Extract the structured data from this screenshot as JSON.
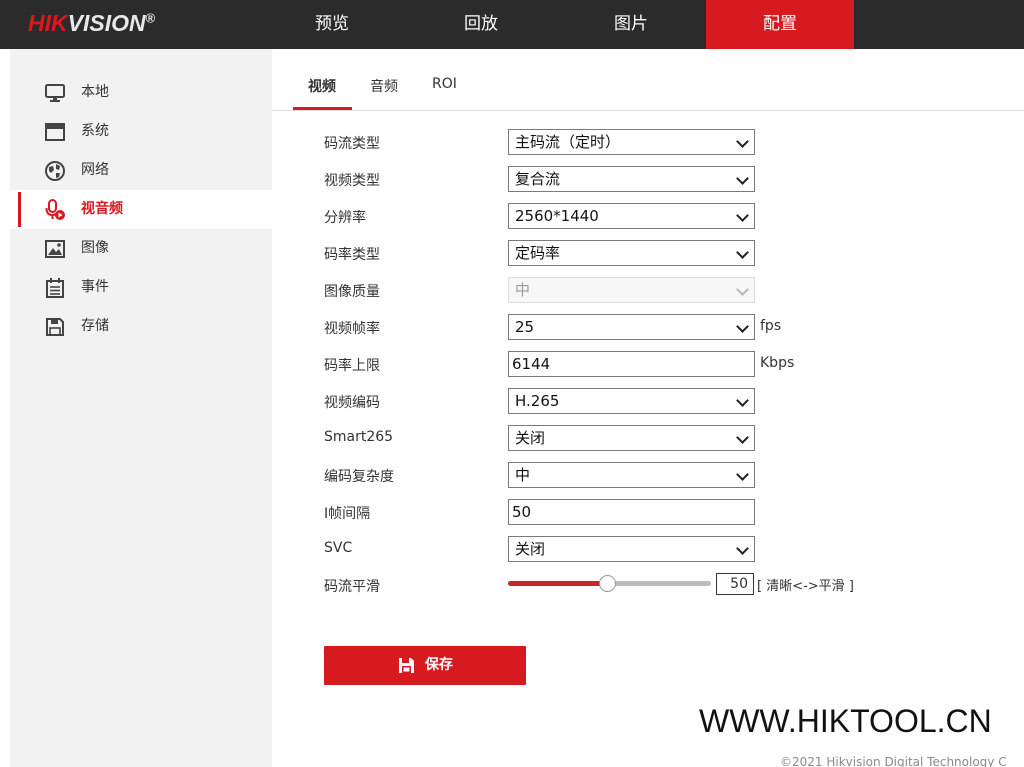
{
  "header": {
    "logo_part1": "HIK",
    "logo_part2": "VISION",
    "logo_reg": "®",
    "nav": [
      "预览",
      "回放",
      "图片",
      "配置"
    ],
    "active_nav": "配置"
  },
  "sidebar": {
    "items": [
      {
        "label": "本地",
        "icon": "monitor-icon"
      },
      {
        "label": "系统",
        "icon": "window-icon"
      },
      {
        "label": "网络",
        "icon": "globe-icon"
      },
      {
        "label": "视音频",
        "icon": "microphone-icon"
      },
      {
        "label": "图像",
        "icon": "image-icon"
      },
      {
        "label": "事件",
        "icon": "calendar-icon"
      },
      {
        "label": "存储",
        "icon": "save-icon"
      }
    ],
    "active": "视音频"
  },
  "tabs": {
    "items": [
      "视频",
      "音频",
      "ROI"
    ],
    "active": "视频"
  },
  "form": {
    "stream_type": {
      "label": "码流类型",
      "value": "主码流（定时）"
    },
    "video_type": {
      "label": "视频类型",
      "value": "复合流"
    },
    "resolution": {
      "label": "分辨率",
      "value": "2560*1440"
    },
    "bitrate_type": {
      "label": "码率类型",
      "value": "定码率"
    },
    "image_quality": {
      "label": "图像质量",
      "value": "中"
    },
    "frame_rate": {
      "label": "视频帧率",
      "value": "25",
      "unit": "fps"
    },
    "max_bitrate": {
      "label": "码率上限",
      "value": "6144",
      "unit": "Kbps"
    },
    "video_encoding": {
      "label": "视频编码",
      "value": "H.265"
    },
    "smart265": {
      "label": "Smart265",
      "value": "关闭"
    },
    "encoding_complexity": {
      "label": "编码复杂度",
      "value": "中"
    },
    "i_frame_interval": {
      "label": "I帧间隔",
      "value": "50"
    },
    "svc": {
      "label": "SVC",
      "value": "关闭"
    },
    "smoothing": {
      "label": "码流平滑",
      "value": "50",
      "fraction": 0.49,
      "hint": "[ 清晰<->平滑 ]"
    }
  },
  "save_button": {
    "label": "保存"
  },
  "watermark": "WWW.HIKTOOL.CN",
  "copyright": "©2021 Hikvision Digital Technology C",
  "colors": {
    "accent": "#d71920",
    "topbar": "#2b2b2b",
    "sidebar": "#f2f2f2"
  }
}
